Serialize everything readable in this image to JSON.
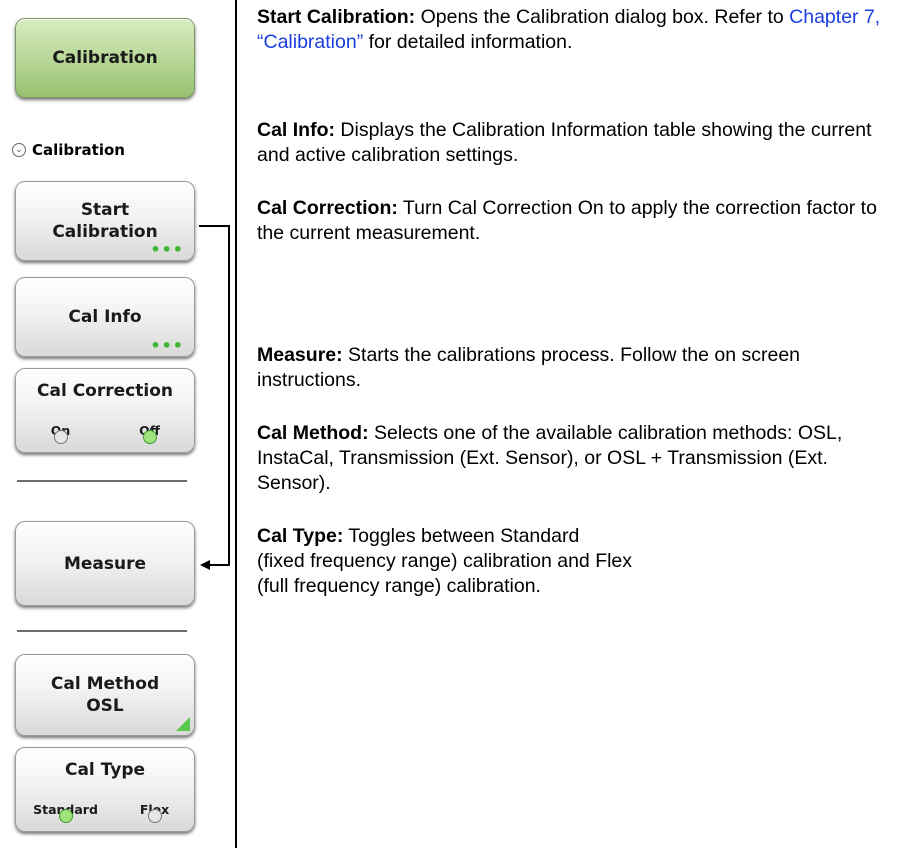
{
  "left_panel": {
    "main_key": "Calibration",
    "menu_title": "Calibration",
    "keys": {
      "start_calibration": [
        "Start",
        "Calibration"
      ],
      "cal_info": "Cal Info",
      "cal_correction": {
        "label": "Cal Correction",
        "on": "On",
        "off": "Off",
        "selected": "Off"
      },
      "measure": "Measure",
      "cal_method": [
        "Cal Method",
        "OSL"
      ],
      "cal_type": {
        "label": "Cal Type",
        "standard": "Standard",
        "flex": "Flex",
        "selected": "Standard"
      }
    }
  },
  "descriptions": {
    "start_calibration": {
      "term": "Start Calibration:",
      "text_before_link": " Opens the Calibration dialog box. Refer to ",
      "link": "Chapter 7, “Calibration”",
      "text_after_link": " for detailed information."
    },
    "cal_info": {
      "term": "Cal Info:",
      "text": " Displays the Calibration Information table showing the current and active calibration settings."
    },
    "cal_correction": {
      "term": "Cal Correction:",
      "text": " Turn Cal Correction On to apply the correction factor to the current measurement."
    },
    "measure": {
      "term": "Measure:",
      "text": "  Starts the calibrations process. Follow the on screen instructions."
    },
    "cal_method": {
      "term": "Cal Method:",
      "text": "  Selects one of the available calibration methods: OSL, InstaCal, Transmission (Ext. Sensor), or OSL + Transmission (Ext. Sensor)."
    },
    "cal_type": {
      "term": "Cal Type:",
      "line1": "  Toggles between Standard",
      "line2": "(fixed frequency range) calibration and Flex",
      "line3": "(full frequency range) calibration."
    }
  },
  "colors": {
    "link": "#1a3ee0",
    "indicator_on": "#9fe37f",
    "main_key": "#b9d89a",
    "dots": "#3fb534"
  }
}
